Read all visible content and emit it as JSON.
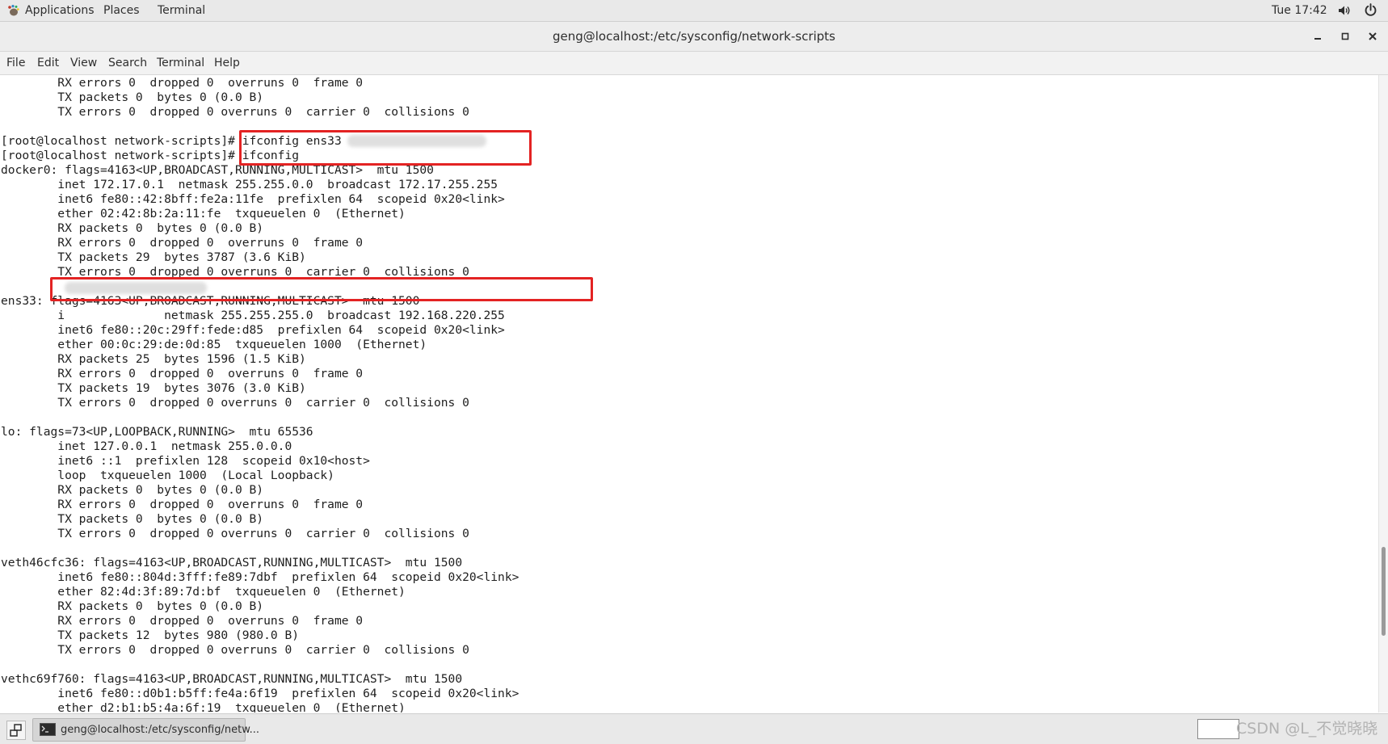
{
  "panel": {
    "applications": "Applications",
    "places": "Places",
    "terminal": "Terminal",
    "clock": "Tue 17:42"
  },
  "window": {
    "title": "geng@localhost:/etc/sysconfig/network-scripts"
  },
  "menu": {
    "file": "File",
    "edit": "Edit",
    "view": "View",
    "search": "Search",
    "terminal": "Terminal",
    "help": "Help"
  },
  "terminal": {
    "lines": [
      "        RX errors 0  dropped 0  overruns 0  frame 0",
      "        TX packets 0  bytes 0 (0.0 B)",
      "        TX errors 0  dropped 0 overruns 0  carrier 0  collisions 0",
      "",
      "[root@localhost network-scripts]# ifconfig ens33",
      "[root@localhost network-scripts]# ifconfig",
      "docker0: flags=4163<UP,BROADCAST,RUNNING,MULTICAST>  mtu 1500",
      "        inet 172.17.0.1  netmask 255.255.0.0  broadcast 172.17.255.255",
      "        inet6 fe80::42:8bff:fe2a:11fe  prefixlen 64  scopeid 0x20<link>",
      "        ether 02:42:8b:2a:11:fe  txqueuelen 0  (Ethernet)",
      "        RX packets 0  bytes 0 (0.0 B)",
      "        RX errors 0  dropped 0  overruns 0  frame 0",
      "        TX packets 29  bytes 3787 (3.6 KiB)",
      "        TX errors 0  dropped 0 overruns 0  carrier 0  collisions 0",
      "",
      "ens33: flags=4163<UP,BROADCAST,RUNNING,MULTICAST>  mtu 1500",
      "        i              netmask 255.255.255.0  broadcast 192.168.220.255",
      "        inet6 fe80::20c:29ff:fede:d85  prefixlen 64  scopeid 0x20<link>",
      "        ether 00:0c:29:de:0d:85  txqueuelen 1000  (Ethernet)",
      "        RX packets 25  bytes 1596 (1.5 KiB)",
      "        RX errors 0  dropped 0  overruns 0  frame 0",
      "        TX packets 19  bytes 3076 (3.0 KiB)",
      "        TX errors 0  dropped 0 overruns 0  carrier 0  collisions 0",
      "",
      "lo: flags=73<UP,LOOPBACK,RUNNING>  mtu 65536",
      "        inet 127.0.0.1  netmask 255.0.0.0",
      "        inet6 ::1  prefixlen 128  scopeid 0x10<host>",
      "        loop  txqueuelen 1000  (Local Loopback)",
      "        RX packets 0  bytes 0 (0.0 B)",
      "        RX errors 0  dropped 0  overruns 0  frame 0",
      "        TX packets 0  bytes 0 (0.0 B)",
      "        TX errors 0  dropped 0 overruns 0  carrier 0  collisions 0",
      "",
      "veth46cfc36: flags=4163<UP,BROADCAST,RUNNING,MULTICAST>  mtu 1500",
      "        inet6 fe80::804d:3fff:fe89:7dbf  prefixlen 64  scopeid 0x20<link>",
      "        ether 82:4d:3f:89:7d:bf  txqueuelen 0  (Ethernet)",
      "        RX packets 0  bytes 0 (0.0 B)",
      "        RX errors 0  dropped 0  overruns 0  frame 0",
      "        TX packets 12  bytes 980 (980.0 B)",
      "        TX errors 0  dropped 0 overruns 0  carrier 0  collisions 0",
      "",
      "vethc69f760: flags=4163<UP,BROADCAST,RUNNING,MULTICAST>  mtu 1500",
      "        inet6 fe80::d0b1:b5ff:fe4a:6f19  prefixlen 64  scopeid 0x20<link>",
      "        ether d2:b1:b5:4a:6f:19  txqueuelen 0  (Ethernet)"
    ]
  },
  "taskbar": {
    "window_label": "geng@localhost:/etc/sysconfig/netw..."
  },
  "watermark": "CSDN @L_不觉晓晓",
  "colors": {
    "highlight": "#e32323",
    "scroll_thumb": "#9a9a9a"
  },
  "scrollbar": {
    "position_fraction": 0.86,
    "visible_fraction": 0.14
  }
}
